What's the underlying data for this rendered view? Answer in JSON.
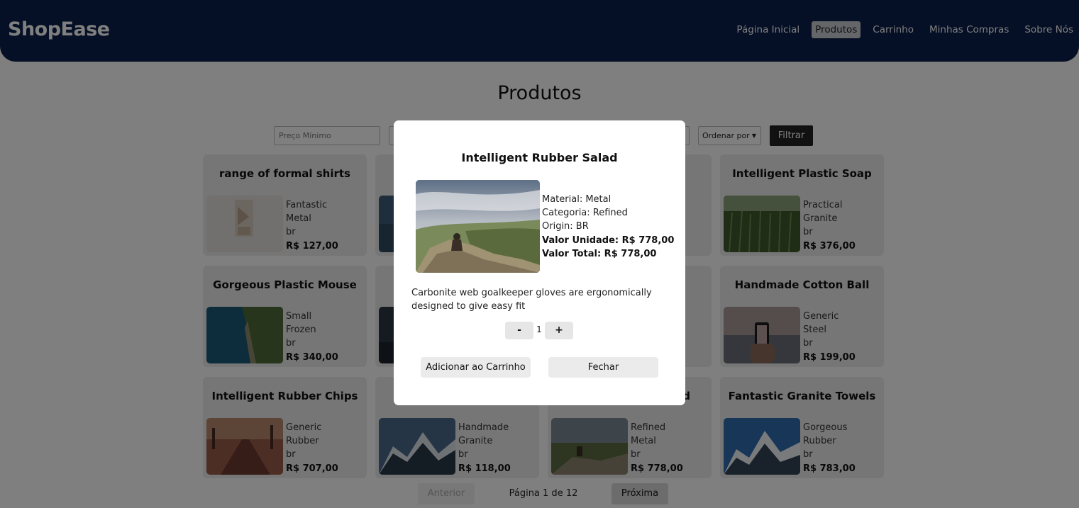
{
  "header": {
    "brand": "ShopEase",
    "nav": [
      {
        "label": "Página Inicial",
        "active": false
      },
      {
        "label": "Produtos",
        "active": true
      },
      {
        "label": "Carrinho",
        "active": false
      },
      {
        "label": "Minhas Compras",
        "active": false
      },
      {
        "label": "Sobre Nós",
        "active": false
      }
    ]
  },
  "page_title": "Produtos",
  "filters": {
    "min_price_placeholder": "Preço Mínimo",
    "sort_label": "Ordenar por",
    "filter_button": "Filtrar"
  },
  "products": [
    {
      "title": "range of formal shirts",
      "line1": "Fantastic",
      "line2": "Metal",
      "line3": "br",
      "price": "R$ 127,00",
      "image": "formal-shirts-photo"
    },
    {
      "title": "",
      "line1": "",
      "line2": "",
      "line3": "",
      "price": "",
      "image": "sea-photo"
    },
    {
      "title": "",
      "line1": "",
      "line2": "",
      "line3": "",
      "price": "",
      "image": "hidden"
    },
    {
      "title": "Intelligent Plastic Soap",
      "line1": "Practical",
      "line2": "Granite",
      "line3": "br",
      "price": "R$ 376,00",
      "image": "wheat-field-photo"
    },
    {
      "title": "Gorgeous Plastic Mouse",
      "line1": "Small",
      "line2": "Frozen",
      "line3": "br",
      "price": "R$ 340,00",
      "image": "coast-photo"
    },
    {
      "title": "",
      "line1": "",
      "line2": "",
      "line3": "",
      "price": "",
      "image": "dark-landscape-photo"
    },
    {
      "title": "",
      "line1": "",
      "line2": "",
      "line3": "",
      "price": "",
      "image": "hidden"
    },
    {
      "title": "Handmade Cotton Ball",
      "line1": "Generic",
      "line2": "Steel",
      "line3": "br",
      "price": "R$ 199,00",
      "image": "phone-beach-photo"
    },
    {
      "title": "Intelligent Rubber Chips",
      "line1": "Generic",
      "line2": "Rubber",
      "line3": "br",
      "price": "R$ 707,00",
      "image": "autumn-road-photo"
    },
    {
      "title": "",
      "line1": "Handmade",
      "line2": "Granite",
      "line3": "br",
      "price": "R$ 118,00",
      "image": "snowy-mountain-photo"
    },
    {
      "title": "d",
      "line1": "Refined",
      "line2": "Metal",
      "line3": "br",
      "price": "R$ 778,00",
      "image": "cliff-person-photo"
    },
    {
      "title": "Fantastic Granite Towels",
      "line1": "Gorgeous",
      "line2": "Rubber",
      "line3": "br",
      "price": "R$ 783,00",
      "image": "snowy-peaks-photo"
    }
  ],
  "pager": {
    "prev": "Anterior",
    "label": "Página 1 de 12",
    "next": "Próxima"
  },
  "modal": {
    "title": "Intelligent Rubber Salad",
    "material": "Material: Metal",
    "category": "Categoria: Refined",
    "origin": "Origin: BR",
    "unit_price": "Valor Unidade: R$ 778,00",
    "total_price": "Valor Total: R$ 778,00",
    "description": "Carbonite web goalkeeper gloves are ergonomically designed to give easy fit",
    "quantity": "1",
    "minus": "-",
    "plus": "+",
    "add_to_cart": "Adicionar ao Carrinho",
    "close": "Fechar",
    "image": "cliff-person-photo"
  },
  "colors": {
    "navbar": "#0b1f4a",
    "card_bg": "#ececec",
    "overlay": "rgba(0,0,0,0.5)",
    "filter_button": "#222222"
  }
}
